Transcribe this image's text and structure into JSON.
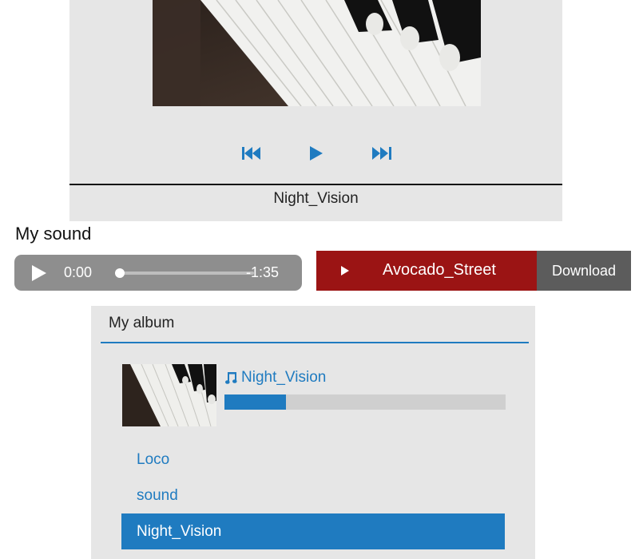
{
  "player": {
    "cover_alt": "piano keys photo",
    "now_playing": "Night_Vision",
    "controls": {
      "previous": "skip-back-icon",
      "play": "play-icon",
      "next": "skip-forward-icon"
    }
  },
  "my_sound": {
    "heading": "My sound",
    "audio": {
      "current_time": "0:00",
      "remaining_time": "-1:35",
      "position_fraction": 0
    },
    "song_button_label": "Avocado_Street",
    "download_label": "Download"
  },
  "album": {
    "title": "My album",
    "current_track": "Night_Vision",
    "progress_fraction": 0.22,
    "playlist": [
      {
        "name": "Loco",
        "active": false
      },
      {
        "name": "sound",
        "active": false
      },
      {
        "name": "Night_Vision",
        "active": true
      }
    ]
  },
  "colors": {
    "accent_blue": "#1f7bc0",
    "song_red": "#9b1414",
    "download_gray": "#5c5c5c",
    "panel_gray": "#e6e6e6"
  }
}
